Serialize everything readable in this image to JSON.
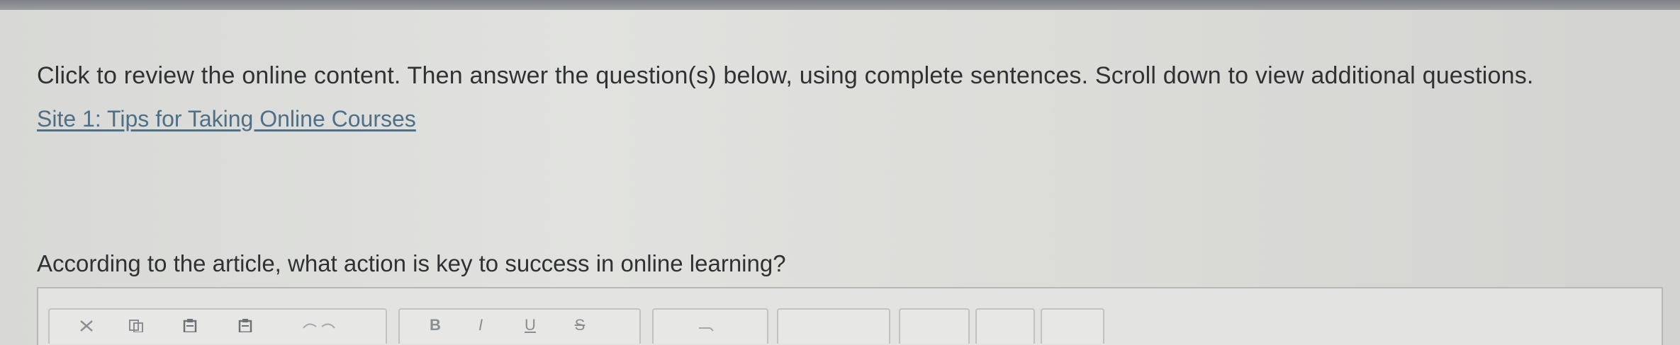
{
  "instructions": {
    "text": "Click to review the online content. Then answer the question(s) below, using complete sentences. Scroll down to view additional questions."
  },
  "site_link": {
    "label": "Site 1: Tips for Taking Online Courses"
  },
  "question": {
    "text": "According to the article, what action is key to success in online learning?"
  },
  "toolbar": {
    "buttons": [
      {
        "icon": "cut-icon"
      },
      {
        "icon": "copy-icon"
      },
      {
        "icon": "paste-icon"
      },
      {
        "icon": "paste-text-icon"
      },
      {
        "icon": "bold-icon",
        "label": "B"
      },
      {
        "icon": "italic-icon",
        "label": "I"
      },
      {
        "icon": "underline-icon",
        "label": "U"
      },
      {
        "icon": "strikethrough-icon",
        "label": "S"
      }
    ]
  },
  "colors": {
    "link": "#4f6f86",
    "text": "#2f3133",
    "background": "#dcdcd9",
    "top_bar": "#8a8d90"
  }
}
